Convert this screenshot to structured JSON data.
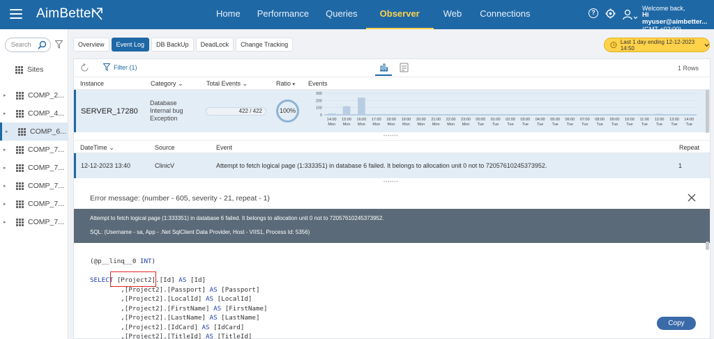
{
  "header": {
    "brand": "AimBetter",
    "nav": [
      "Home",
      "Performance",
      "Queries",
      "Observer",
      "Web",
      "Connections"
    ],
    "active_nav": "Observer",
    "welcome": "Welcome back,",
    "user": "Hi myuser@aimbetter...",
    "timezone": "(GMT +02:00)"
  },
  "sidebar": {
    "search_placeholder": "Search",
    "sites_label": "Sites",
    "items": [
      "COMP_2...",
      "COMP_4...",
      "COMP_6...",
      "COMP_7...",
      "COMP_7...",
      "COMP_7...",
      "COMP_7...",
      "COMP_7..."
    ],
    "selected_index": 2
  },
  "tabs": [
    "Overview",
    "Event Log",
    "DB BackUp",
    "DeadLock",
    "Change Tracking"
  ],
  "active_tab": "Event Log",
  "date_range": "Last 1 day ending  12-12-2023 14:50",
  "toolbar": {
    "filter": "Filter (1)",
    "rows": "1 Rows"
  },
  "instance_table": {
    "headers": {
      "instance": "Instance",
      "category": "Category",
      "total": "Total Events",
      "ratio": "Ratio",
      "events": "Events"
    },
    "row": {
      "instance": "SERVER_17280",
      "category": [
        "Database",
        "Internal bug",
        "Exception"
      ],
      "total_text": "422 / 422",
      "ratio": "100%"
    }
  },
  "chart_data": {
    "type": "bar",
    "yticks": [
      "300",
      "200",
      "100",
      "0"
    ],
    "ylim": [
      0,
      300
    ],
    "categories": [
      "14:00",
      "15:00",
      "16:00",
      "17:00",
      "18:00",
      "19:00",
      "20:00",
      "21:00",
      "22:00",
      "23:00",
      "00:00",
      "01:00",
      "02:00",
      "03:00",
      "04:00",
      "05:00",
      "06:00",
      "07:00",
      "08:00",
      "09:00",
      "10:00",
      "11:00",
      "12:00",
      "13:00",
      "14:00"
    ],
    "days": [
      "Mon",
      "Mon",
      "Mon",
      "Mon",
      "Mon",
      "Mon",
      "Mon",
      "Mon",
      "Mon",
      "Mon",
      "Tue",
      "Tue",
      "Tue",
      "Tue",
      "Tue",
      "Tue",
      "Tue",
      "Tue",
      "Tue",
      "Tue",
      "Tue",
      "Tue",
      "Tue",
      "Tue",
      "Tue"
    ],
    "values": [
      20,
      120,
      240,
      5,
      2,
      2,
      2,
      2,
      2,
      2,
      2,
      2,
      2,
      2,
      2,
      2,
      2,
      2,
      2,
      2,
      2,
      10,
      15,
      3,
      5
    ]
  },
  "log_table": {
    "headers": {
      "datetime": "DateTime",
      "source": "Source",
      "event": "Event",
      "repeat": "Repeat"
    },
    "row": {
      "datetime": "12-12-2023 13:40",
      "source": "ClinicV",
      "event": "Attempt to fetch logical page (1:333351) in database 6 failed. It belongs to allocation unit 0 not to 72057610245373952.",
      "repeat": "1"
    }
  },
  "error": {
    "title": "Error message: (number - 605, severity - 21, repeat - 1)",
    "line1": "Attempt to fetch logical page (1:333351) in database 6 failed. It belongs to allocation unit 0 not to 72057610245373952.",
    "line2": "SQL: (Username - sa, App - .Net SqlClient Data Provider, Host - VIIS1, Process Id: 5356)"
  },
  "code": {
    "param_a": "(@p__linq__0 ",
    "param_b": "INT",
    "param_c": ")",
    "select_kw": "SELECT",
    "first_tbl": "[Project2].",
    "first_col": "[Id]",
    "as_kw": "AS",
    "first_alias": "[Id]",
    "cols": [
      {
        "prefix": ",[Project2].",
        "col": "[Passport]",
        "alias": "[Passport]"
      },
      {
        "prefix": ",[Project2].",
        "col": "[LocalId]",
        "alias": "[LocalId]"
      },
      {
        "prefix": ",[Project2].",
        "col": "[FirstName]",
        "alias": "[FirstName]"
      },
      {
        "prefix": ",[Project2].",
        "col": "[LastName]",
        "alias": "[LastName]"
      },
      {
        "prefix": ",[Project2].",
        "col": "[IdCard]",
        "alias": "[IdCard]"
      },
      {
        "prefix": ",[Project2].",
        "col": "[TitleId]",
        "alias": "[TitleId]"
      }
    ]
  },
  "copy_button": "Copy"
}
